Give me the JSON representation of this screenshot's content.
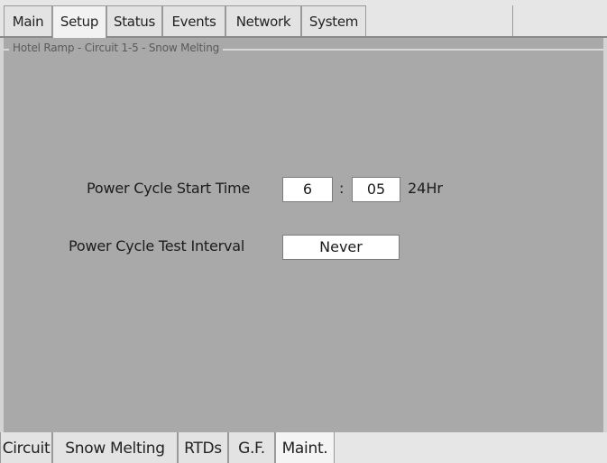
{
  "top_tabs": [
    {
      "label": "Main"
    },
    {
      "label": "Setup"
    },
    {
      "label": "Status"
    },
    {
      "label": "Events"
    },
    {
      "label": "Network"
    },
    {
      "label": "System"
    }
  ],
  "group_title": "Hotel Ramp - Circuit 1-5 - Snow Melting",
  "start_time": {
    "label": "Power Cycle Start Time",
    "hour": "6",
    "separator": ":",
    "minute": "05",
    "unit": "24Hr"
  },
  "test_interval": {
    "label": "Power Cycle Test Interval",
    "value": "Never"
  },
  "bottom_tabs": [
    {
      "label": "Circuit"
    },
    {
      "label": "Snow Melting"
    },
    {
      "label": "RTDs"
    },
    {
      "label": "G.F."
    },
    {
      "label": "Maint."
    }
  ],
  "colors": {
    "panel_bg": "#a9a9a9",
    "tab_bg": "#e3e3e3",
    "active_tab_bg": "#f2f2f2",
    "field_bg": "#ffffff"
  }
}
